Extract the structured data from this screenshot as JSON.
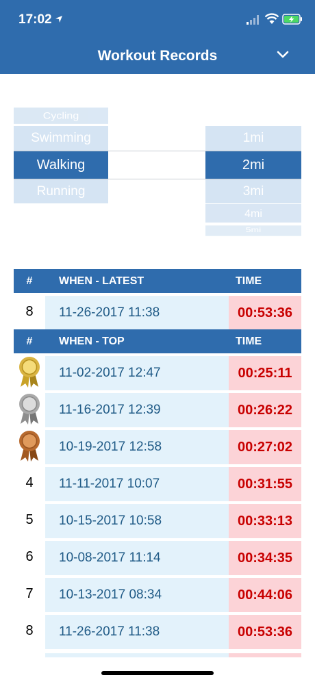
{
  "status_bar": {
    "time": "17:02"
  },
  "nav": {
    "title": "Workout Records"
  },
  "activity_picker": [
    "Cycling",
    "Swimming",
    "Walking",
    "Running"
  ],
  "distance_picker": [
    "1mi",
    "2mi",
    "3mi",
    "4mi",
    "5mi"
  ],
  "latest": {
    "headers": [
      "#",
      "WHEN - LATEST",
      "TIME"
    ],
    "row": {
      "rank": "8",
      "when": "11-26-2017 11:38",
      "time": "00:53:36"
    }
  },
  "top": {
    "headers": [
      "#",
      "WHEN - TOP",
      "TIME"
    ],
    "rows": [
      {
        "rank": "",
        "medal": "gold-medal",
        "when": "11-02-2017 12:47",
        "time": "00:25:11"
      },
      {
        "rank": "",
        "medal": "silver-medal",
        "when": "11-16-2017 12:39",
        "time": "00:26:22"
      },
      {
        "rank": "",
        "medal": "bronze-medal",
        "when": "10-19-2017 12:58",
        "time": "00:27:02"
      },
      {
        "rank": "4",
        "when": "11-11-2017 10:07",
        "time": "00:31:55"
      },
      {
        "rank": "5",
        "when": "10-15-2017 10:58",
        "time": "00:33:13"
      },
      {
        "rank": "6",
        "when": "10-08-2017 11:14",
        "time": "00:34:35"
      },
      {
        "rank": "7",
        "when": "10-13-2017 08:34",
        "time": "00:44:06"
      },
      {
        "rank": "8",
        "when": "11-26-2017 11:38",
        "time": "00:53:36"
      }
    ]
  },
  "colors": {
    "primary": "#2f6cad",
    "date_bg": "#e3f2fb",
    "time_bg": "#fcd3d7",
    "time_text": "#c80000"
  }
}
